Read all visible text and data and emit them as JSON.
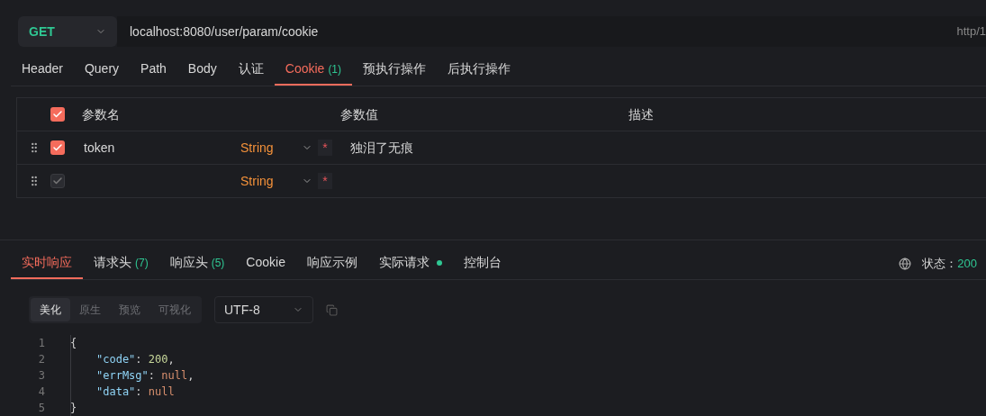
{
  "request": {
    "method": "GET",
    "url": "localhost:8080/user/param/cookie",
    "protocol": "http/1"
  },
  "tabs": [
    {
      "label": "Header",
      "selected": false
    },
    {
      "label": "Query",
      "selected": false
    },
    {
      "label": "Path",
      "selected": false
    },
    {
      "label": "Body",
      "selected": false
    },
    {
      "label": "认证",
      "selected": false
    },
    {
      "label": "Cookie",
      "count": "(1)",
      "selected": true
    },
    {
      "label": "预执行操作",
      "selected": false
    },
    {
      "label": "后执行操作",
      "selected": false
    }
  ],
  "params_table": {
    "all_checked": true,
    "columns": [
      "参数名",
      "参数值",
      "描述"
    ],
    "rows": [
      {
        "name": "token",
        "type": "String",
        "required_mark": "*",
        "value": "独泪了无痕",
        "checked": true,
        "disabled": false
      },
      {
        "name": "",
        "type": "String",
        "required_mark": "*",
        "value": "",
        "checked": true,
        "disabled": true
      }
    ]
  },
  "response_tabs": [
    {
      "label": "实时响应",
      "selected": true
    },
    {
      "label": "请求头",
      "count": "(7)",
      "selected": false
    },
    {
      "label": "响应头",
      "count": "(5)",
      "selected": false
    },
    {
      "label": "Cookie",
      "selected": false
    },
    {
      "label": "响应示例",
      "selected": false
    },
    {
      "label": "实际请求",
      "dot": true,
      "selected": false
    },
    {
      "label": "控制台",
      "selected": false
    }
  ],
  "status": {
    "label": "状态：",
    "code": "200"
  },
  "view_modes": [
    {
      "label": "美化",
      "selected": true
    },
    {
      "label": "原生",
      "selected": false
    },
    {
      "label": "预览",
      "selected": false
    },
    {
      "label": "可视化",
      "selected": false
    }
  ],
  "encoding": "UTF-8",
  "code_lines": [
    {
      "number": "1",
      "indented": false,
      "tokens": [
        {
          "kind": "punct",
          "text": "{"
        }
      ]
    },
    {
      "number": "2",
      "indented": true,
      "tokens": [
        {
          "kind": "key",
          "text": "\"code\""
        },
        {
          "kind": "punct",
          "text": ": "
        },
        {
          "kind": "number",
          "text": "200"
        },
        {
          "kind": "punct",
          "text": ","
        }
      ]
    },
    {
      "number": "3",
      "indented": true,
      "tokens": [
        {
          "kind": "key",
          "text": "\"errMsg\""
        },
        {
          "kind": "punct",
          "text": ": "
        },
        {
          "kind": "null",
          "text": "null"
        },
        {
          "kind": "punct",
          "text": ","
        }
      ]
    },
    {
      "number": "4",
      "indented": true,
      "tokens": [
        {
          "kind": "key",
          "text": "\"data\""
        },
        {
          "kind": "punct",
          "text": ": "
        },
        {
          "kind": "null",
          "text": "null"
        }
      ]
    },
    {
      "number": "5",
      "indented": false,
      "tokens": [
        {
          "kind": "punct",
          "text": "}"
        }
      ]
    }
  ]
}
